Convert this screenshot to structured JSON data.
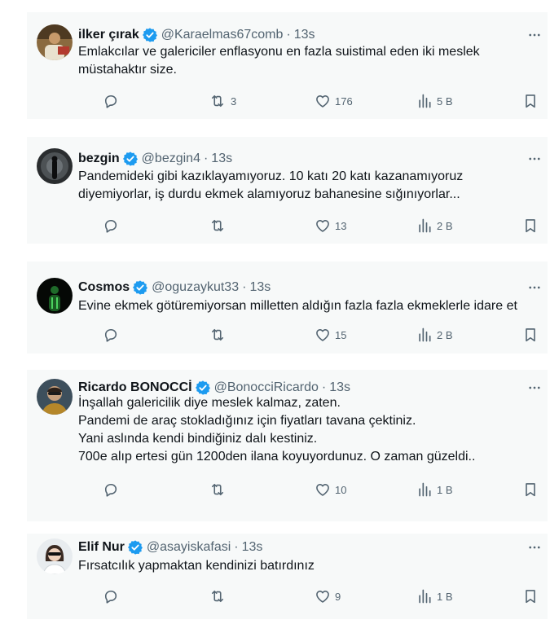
{
  "tweets": [
    {
      "name": "ilker çırak",
      "handle": "@Karaelmas67comb",
      "separator": "·",
      "time": "13s",
      "lines": [
        "Emlakcılar ve galericiler enflasyonu en fazla suistimal eden iki meslek",
        "müstahaktır size."
      ],
      "replies": "",
      "retweets": "3",
      "likes": "176",
      "views": "5 B"
    },
    {
      "name": "bezgin",
      "handle": "@bezgin4",
      "separator": "·",
      "time": "13s",
      "lines": [
        "Pandemideki gibi kazıklayamıyoruz. 10 katı 20 katı kazanamıyoruz",
        "diyemiyorlar, iş durdu ekmek alamıyoruz bahanesine sığınıyorlar..."
      ],
      "replies": "",
      "retweets": "",
      "likes": "13",
      "views": "2 B"
    },
    {
      "name": "Cosmos",
      "handle": "@oguzaykut33",
      "separator": "·",
      "time": "13s",
      "lines": [
        "Evine ekmek götüremiyorsan milletten aldığın fazla fazla ekmeklerle idare et"
      ],
      "replies": "",
      "retweets": "",
      "likes": "15",
      "views": "2 B"
    },
    {
      "name": "Ricardo BONOCCİ",
      "handle": "@BonocciRicardo",
      "separator": "·",
      "time": "13s",
      "lines": [
        "İnşallah galericilik diye meslek kalmaz, zaten.",
        "Pandemi de araç stokladığınız için fiyatları tavana çektiniz.",
        "Yani aslında kendi bindiğiniz dalı kestiniz.",
        "700e alıp ertesi gün 1200den ilana koyuyordunuz. O zaman güzeldi.."
      ],
      "replies": "",
      "retweets": "",
      "likes": "10",
      "views": "1 B"
    },
    {
      "name": "Elif Nur",
      "handle": "@asayiskafasi",
      "separator": "·",
      "time": "13s",
      "lines": [
        "Fırsatcılık yapmaktan kendinizi batırdınız"
      ],
      "replies": "",
      "retweets": "",
      "likes": "9",
      "views": "1 B"
    }
  ],
  "colors": {
    "card_bg": "#f7f9f9",
    "text": "#0f1419",
    "secondary": "#536471",
    "verified": "#1d9bf0"
  },
  "icons": [
    "more-icon",
    "verified-icon",
    "reply-icon",
    "retweet-icon",
    "like-icon",
    "views-icon",
    "bookmark-icon",
    "share-icon"
  ]
}
